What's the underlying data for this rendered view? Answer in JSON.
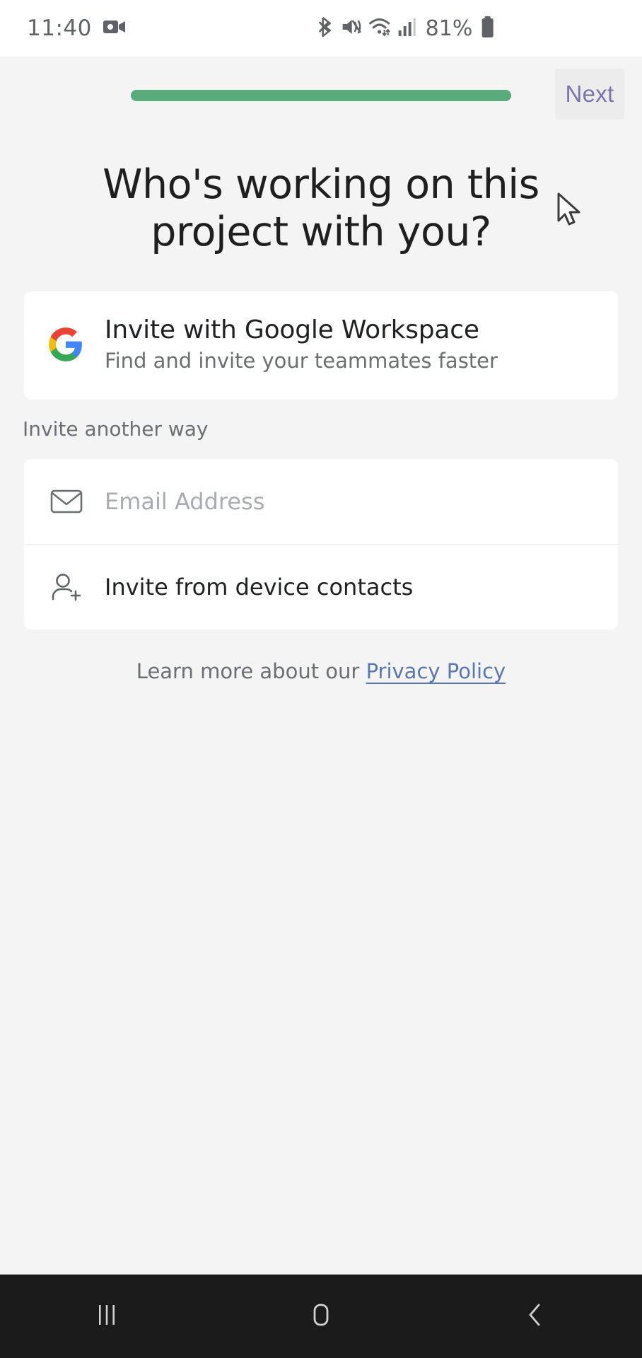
{
  "status_bar": {
    "time": "11:40",
    "battery_percent": "81%",
    "icons": [
      "video-camera-icon",
      "bluetooth-icon",
      "mute-vibrate-icon",
      "wifi-icon",
      "cellular-signal-icon",
      "battery-icon"
    ]
  },
  "header": {
    "progress_percent": 100,
    "progress_color": "#5aab7c",
    "next_label": "Next",
    "next_color": "#7b74ab"
  },
  "main": {
    "headline": "Who's working on this project with you?",
    "google_card": {
      "title": "Invite with Google Workspace",
      "subtitle": "Find and invite your teammates faster",
      "logo": "google-g-logo"
    },
    "section_label": "Invite another way",
    "email_row": {
      "placeholder": "Email Address",
      "value": "",
      "icon": "envelope-icon"
    },
    "contacts_row": {
      "label": "Invite from device contacts",
      "icon": "person-add-icon"
    },
    "privacy": {
      "text": "Learn more about our",
      "link_label": "Privacy Policy",
      "link_color": "#5b77b0"
    }
  },
  "nav_bar": {
    "recents_label": "recent-apps",
    "home_label": "home",
    "back_label": "back"
  }
}
